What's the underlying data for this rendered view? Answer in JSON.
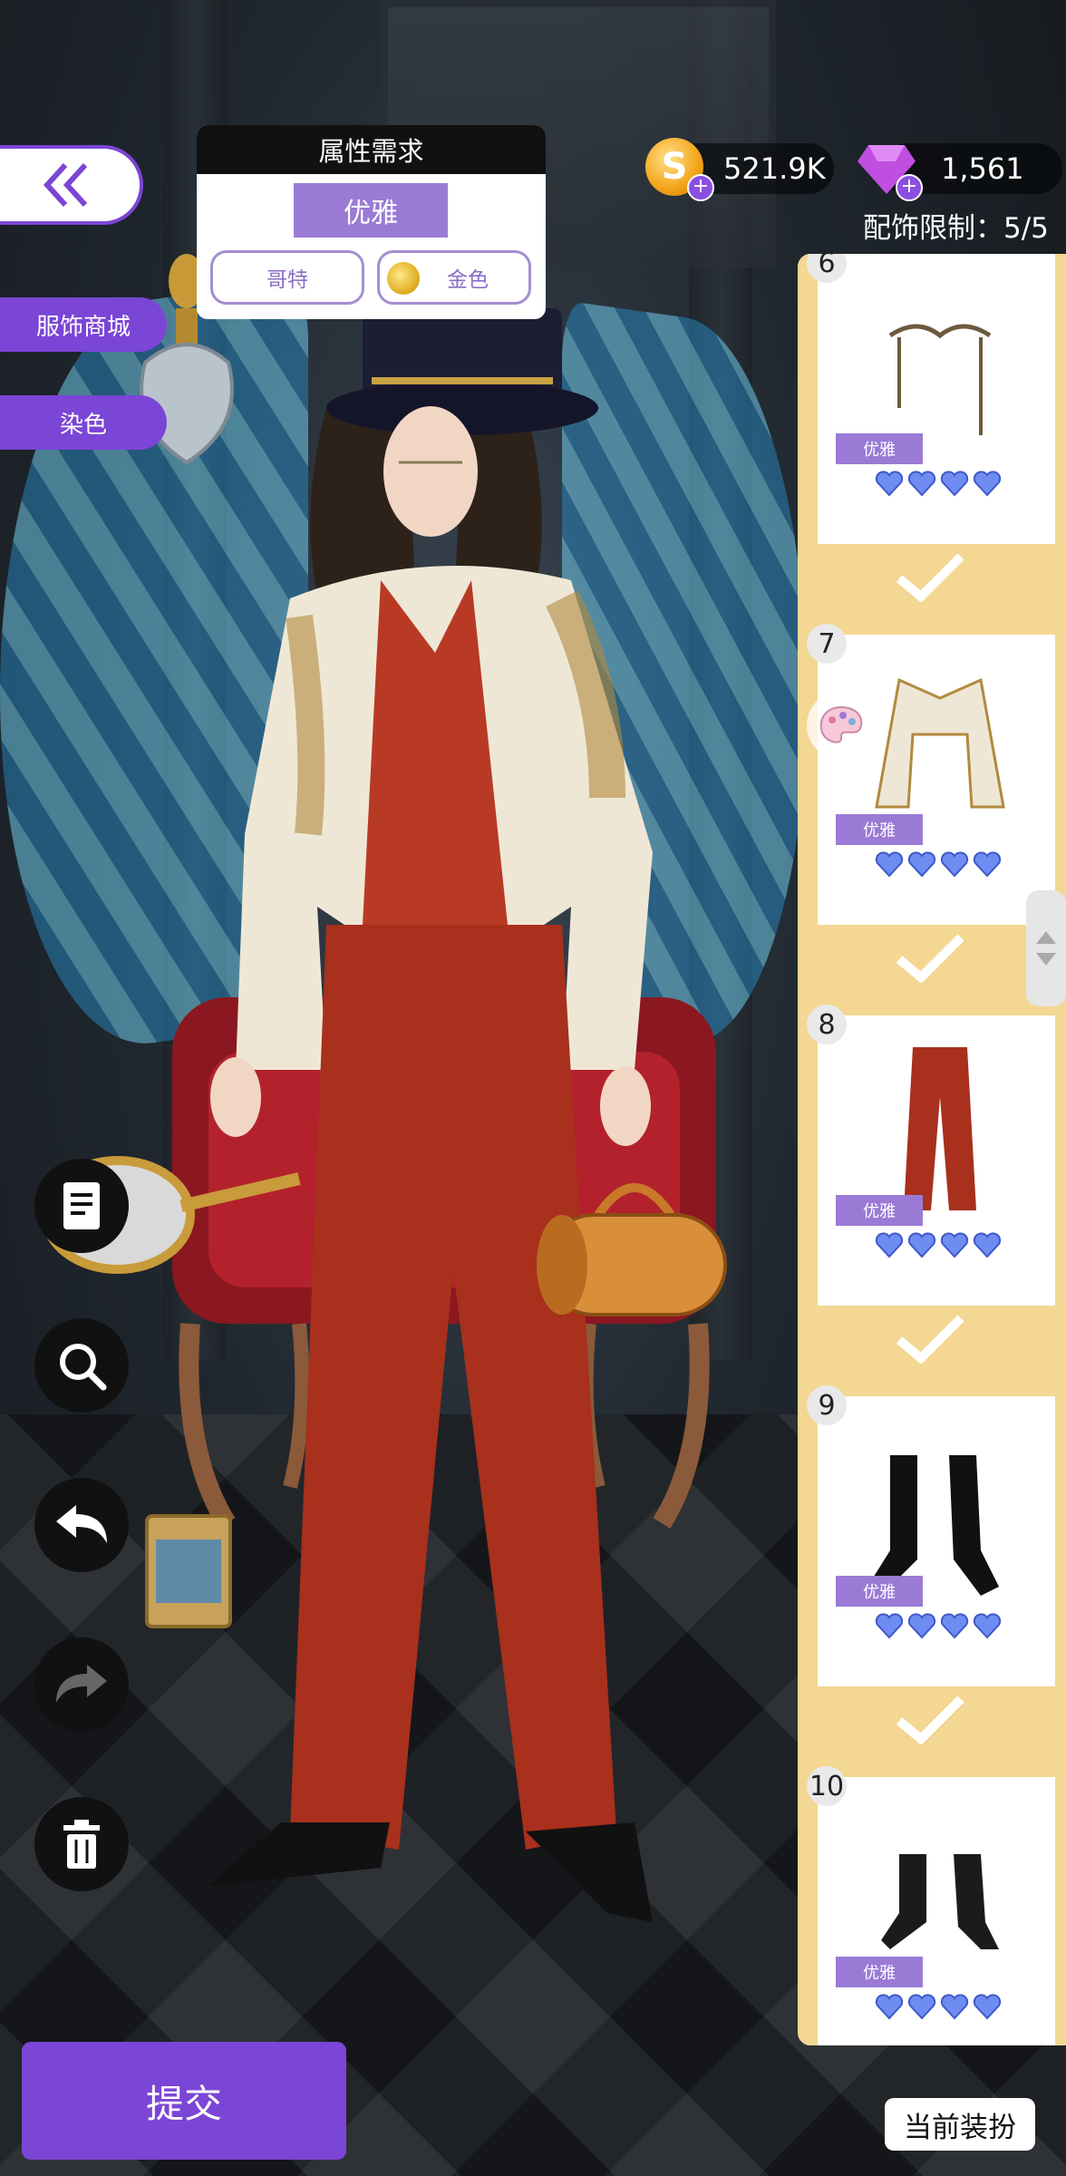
{
  "requirement_panel": {
    "title": "属性需求",
    "main_attribute": "优雅",
    "tags": [
      "哥特",
      "金色"
    ]
  },
  "currency": {
    "coins": "521.9K",
    "gems": "1,561",
    "coin_symbol": "S",
    "accessory_limit": "配饰限制：5/5"
  },
  "side_tabs": {
    "shop": "服饰商城",
    "dye": "染色"
  },
  "items": [
    {
      "number": "6",
      "tag": "优雅",
      "hearts": 4,
      "selected": true,
      "icon": "chain-glasses"
    },
    {
      "number": "7",
      "tag": "优雅",
      "hearts": 4,
      "selected": true,
      "icon": "jacket"
    },
    {
      "number": "8",
      "tag": "优雅",
      "hearts": 4,
      "selected": true,
      "icon": "red-pants"
    },
    {
      "number": "9",
      "tag": "优雅",
      "hearts": 4,
      "selected": true,
      "icon": "black-boots"
    },
    {
      "number": "10",
      "tag": "优雅",
      "hearts": 4,
      "selected": false,
      "icon": "ankle-boots"
    }
  ],
  "tools": [
    "notes-icon",
    "zoom-icon",
    "undo-icon",
    "redo-icon",
    "trash-icon"
  ],
  "buttons": {
    "submit": "提交",
    "current_outfit": "当前装扮"
  },
  "colors": {
    "accent_purple": "#7b45d6",
    "attr_purple": "#9b7ad6",
    "panel_gold": "#f3d792",
    "heart_blue": "#6f8cf2"
  }
}
